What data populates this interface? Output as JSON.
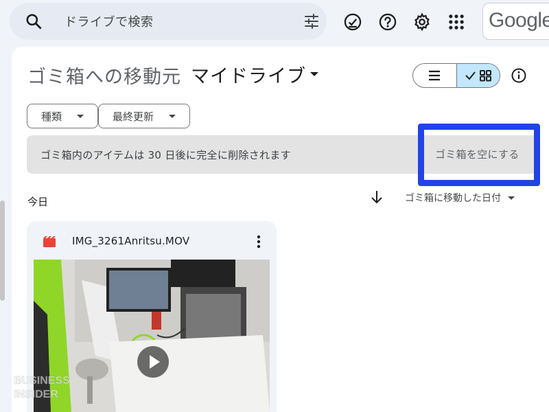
{
  "search": {
    "placeholder": "ドライブで検索"
  },
  "topbar": {
    "icons": [
      "search-icon",
      "filter-sliders-icon",
      "offline-status-icon",
      "help-icon",
      "gear-icon",
      "apps-grid-icon"
    ],
    "logo_text": "Google"
  },
  "header": {
    "title": "ゴミ箱への移動元",
    "location": "マイドライブ"
  },
  "filters": [
    {
      "label": "種類"
    },
    {
      "label": "最終更新"
    }
  ],
  "banner": {
    "message": "ゴミ箱内のアイテムは 30 日後に完全に削除されます",
    "empty_button": "ゴミ箱を空にする"
  },
  "list": {
    "section_label": "今日",
    "sort_label": "ゴミ箱に移動した日付"
  },
  "files": [
    {
      "name": "IMG_3261Anritsu.MOV",
      "type": "video"
    }
  ],
  "watermark": {
    "text": "BUSINESS INSIDER"
  },
  "colors": {
    "accent_blue": "#2244e6",
    "toggle_selected": "#c2e7ff",
    "video_icon_red": "#ea4335",
    "background": "#f0f4f9"
  }
}
